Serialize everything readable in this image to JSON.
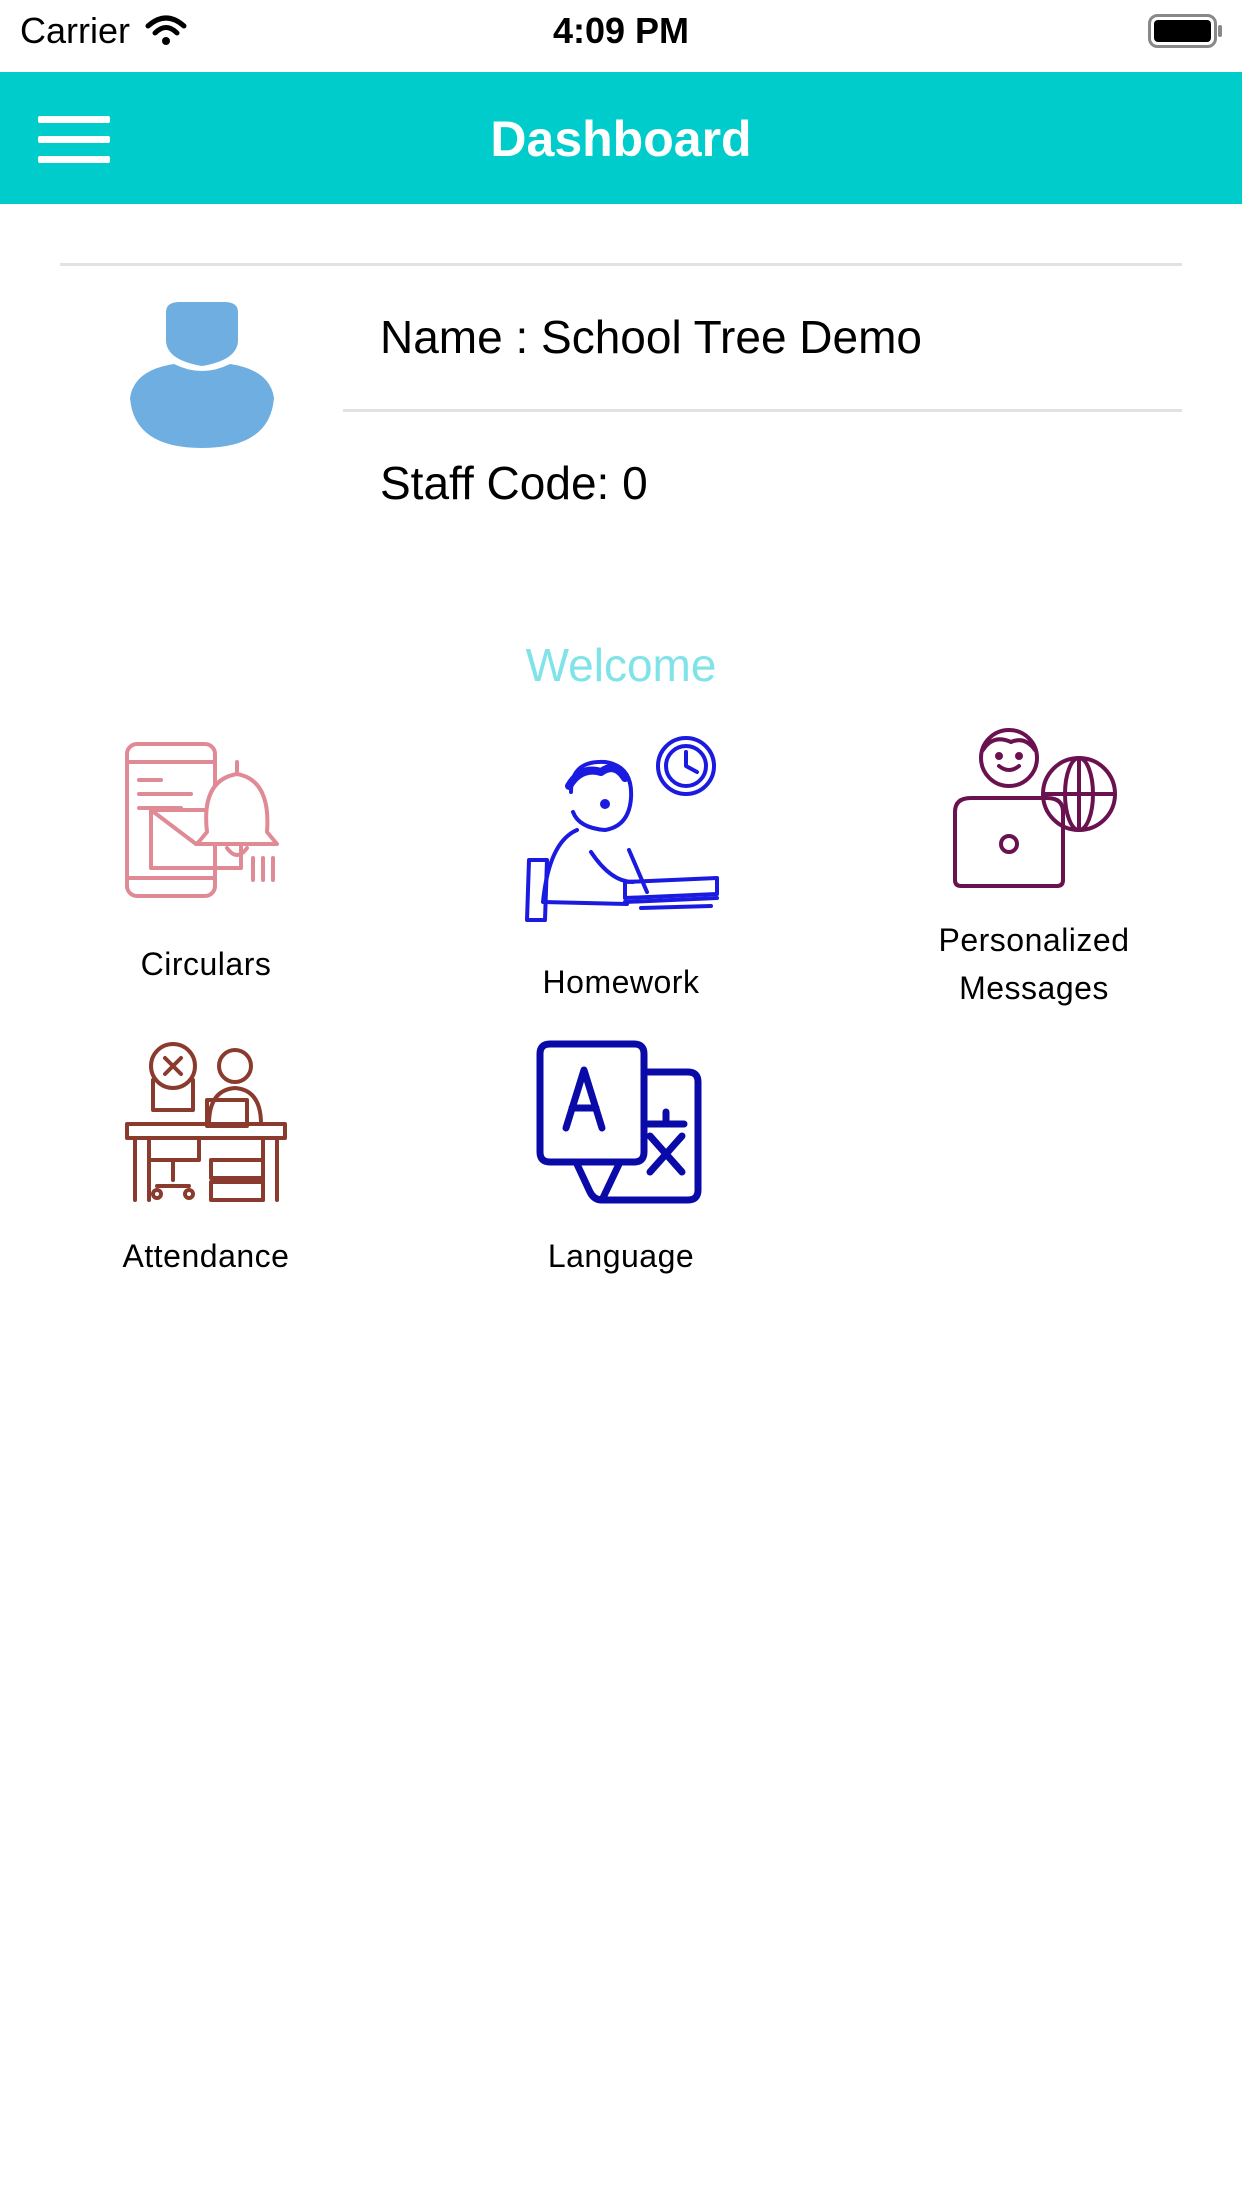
{
  "status_bar": {
    "carrier": "Carrier",
    "time": "4:09 PM"
  },
  "header": {
    "title": "Dashboard"
  },
  "profile": {
    "name": "Name : School Tree Demo",
    "staff_code": "Staff Code: 0"
  },
  "welcome": "Welcome",
  "menu": {
    "circulars": "Circulars",
    "homework": "Homework",
    "personalized_1": "Personalized",
    "personalized_2": "Messages",
    "attendance": "Attendance",
    "language": "Language"
  },
  "colors": {
    "header_bg": "#00CDCB",
    "welcome": "#7FE3E8",
    "circulars_icon": "#E08A96",
    "homework_icon": "#1A1AE0",
    "personalized_icon": "#6A1150",
    "attendance_icon": "#8B3A2E",
    "language_icon": "#0A0AA8",
    "avatar": "#6FAEE0"
  }
}
